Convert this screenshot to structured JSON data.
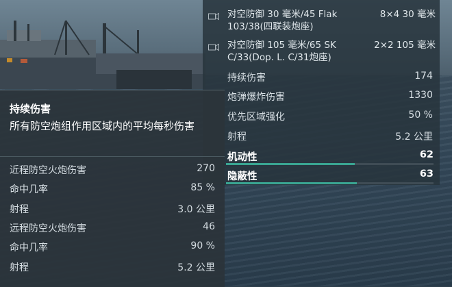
{
  "armament": [
    {
      "name": "对空防御 30 毫米/45 Flak 103/38(四联装炮座)",
      "count": "8×4 30 毫米",
      "icon": "camera-icon"
    },
    {
      "name": "对空防御 105 毫米/65 SK C/33(Dop. L. C/31炮座)",
      "count": "2×2 105 毫米",
      "icon": "camera-icon"
    }
  ],
  "stats": [
    {
      "label": "持续伤害",
      "value": "174"
    },
    {
      "label": "炮弹爆炸伤害",
      "value": "1330"
    },
    {
      "label": "优先区域强化",
      "value": "50 %"
    },
    {
      "label": "射程",
      "value": "5.2 公里"
    }
  ],
  "categories": [
    {
      "label": "机动性",
      "value": "62",
      "fill": 0.62
    },
    {
      "label": "隐蔽性",
      "value": "63",
      "fill": 0.63
    }
  ],
  "tooltip": {
    "title": "持续伤害",
    "description": "所有防空炮组作用区域内的平均每秒伤害",
    "rows": [
      {
        "label": "近程防空火炮伤害",
        "value": "270"
      },
      {
        "label": "命中几率",
        "value": "85 %"
      },
      {
        "label": "射程",
        "value": "3.0 公里"
      },
      {
        "label": "远程防空火炮伤害",
        "value": "46"
      },
      {
        "label": "命中几率",
        "value": "90 %"
      },
      {
        "label": "射程",
        "value": "5.2 公里"
      }
    ]
  },
  "colors": {
    "accent": "#3aa592",
    "panel": "#28343c"
  }
}
